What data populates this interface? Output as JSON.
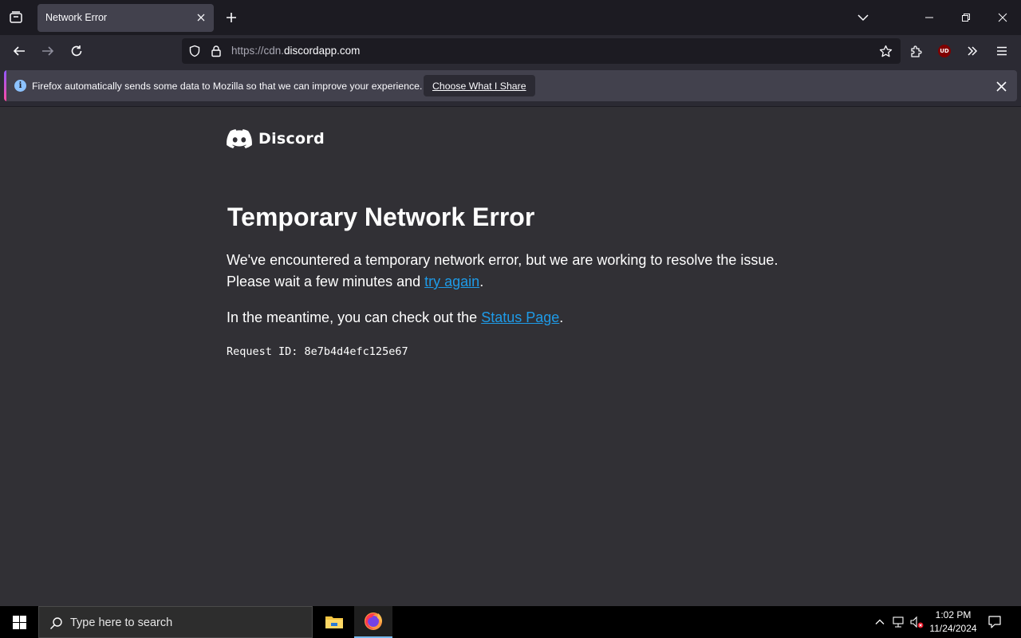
{
  "browser": {
    "tab": {
      "title": "Network Error"
    },
    "url": {
      "prefix": "https://cdn.",
      "domain": "discordapp.com"
    },
    "extension_badge": "UD"
  },
  "notification": {
    "message": "Firefox automatically sends some data to Mozilla so that we can improve your experience.",
    "button_label": "Choose What I Share",
    "info_glyph": "i"
  },
  "page": {
    "logo_text": "Discord",
    "title": "Temporary Network Error",
    "para1_line1": "We've encountered a temporary network error, but we are working to resolve the issue.",
    "para1_line2_prefix": "Please wait a few minutes and ",
    "para1_link": "try again",
    "para1_suffix": ".",
    "para2_prefix": "In the meantime, you can check out the ",
    "para2_link": "Status Page",
    "para2_suffix": ".",
    "request_id": "Request ID: 8e7b4d4efc125e67"
  },
  "taskbar": {
    "search_placeholder": "Type here to search",
    "time": "1:02 PM",
    "date": "11/24/2024"
  },
  "colors": {
    "link": "#1e9be8",
    "page_bg": "#313035",
    "chrome_bg": "#2b2a33",
    "tabstrip_bg": "#1c1b22"
  }
}
